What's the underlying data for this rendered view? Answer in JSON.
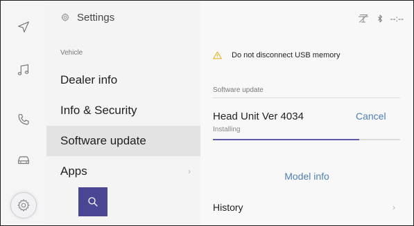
{
  "rail": {
    "items": [
      {
        "icon": "navigation-icon"
      },
      {
        "icon": "music-icon"
      },
      {
        "icon": "phone-icon"
      },
      {
        "icon": "car-icon"
      },
      {
        "icon": "settings-icon",
        "active": true
      }
    ]
  },
  "menu": {
    "header": "Settings",
    "section_label": "Vehicle",
    "items": [
      {
        "label": "Dealer info"
      },
      {
        "label": "Info & Security"
      },
      {
        "label": "Software update",
        "selected": true
      },
      {
        "label": "Apps"
      }
    ],
    "apps_chevron": "›"
  },
  "status": {
    "clock": "--:--"
  },
  "main": {
    "warning": "Do not disconnect USB memory",
    "section_label": "Software update",
    "head_unit": "Head Unit Ver 4034",
    "cancel_label": "Cancel",
    "status_text": "Installing",
    "progress_fraction": 0.78,
    "model_info_label": "Model info",
    "history_label": "History",
    "history_chevron": "›"
  },
  "colors": {
    "accent": "#4b4694",
    "link": "#4e7fb2",
    "progress": "#5f5aa6",
    "warning": "#e8b22a"
  }
}
